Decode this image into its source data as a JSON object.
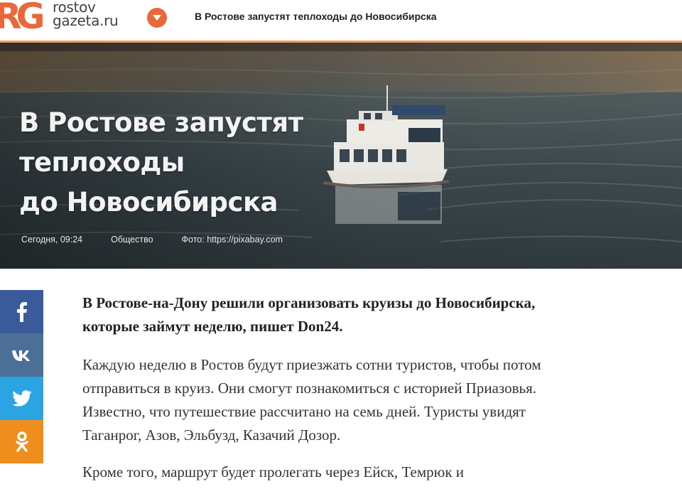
{
  "header": {
    "logo_line1": "rostov",
    "logo_line2": "gazeta.ru",
    "logo_mark": "rg-logo",
    "menu_icon": "chevron-down-icon",
    "title": "В Ростове запустят теплоходы до Новосибирска",
    "accent_color": "#e8683a"
  },
  "hero": {
    "title_line1": "В Ростове запустят",
    "title_line2": "теплоходы",
    "title_line3": "до Новосибирска",
    "date": "Сегодня, 09:24",
    "category": "Общество",
    "photo_credit": "Фото: https://pixabay.com"
  },
  "social": [
    {
      "network": "facebook",
      "icon": "facebook-icon",
      "glyph": "f",
      "color": "#3b5a9a"
    },
    {
      "network": "vk",
      "icon": "vk-icon",
      "glyph": "vk",
      "color": "#4b6f96"
    },
    {
      "network": "twitter",
      "icon": "twitter-icon",
      "glyph": "bird",
      "color": "#2ba4e3"
    },
    {
      "network": "odnoklassniki",
      "icon": "odnoklassniki-icon",
      "glyph": "ok",
      "color": "#ef8e1d"
    }
  ],
  "article": {
    "lead_line1": "В Ростове-на-Дону решили организовать круизы до Новосибирска,",
    "lead_line2": "которые займут неделю, пишет Don24.",
    "p1_line1": "Каждую неделю в Ростов будут приезжать сотни туристов, чтобы потом",
    "p1_line2": "отправиться в круиз. Они смогут познакомиться с историей Приазовья.",
    "p1_line3": "Известно, что путешествие рассчитано на семь дней. Туристы увидят",
    "p1_line4": "Таганрог, Азов, Эльбузд, Казачий Дозор.",
    "p2_line1": "Кроме того, маршрут будет пролегать через Ейск, Темрюк и"
  }
}
